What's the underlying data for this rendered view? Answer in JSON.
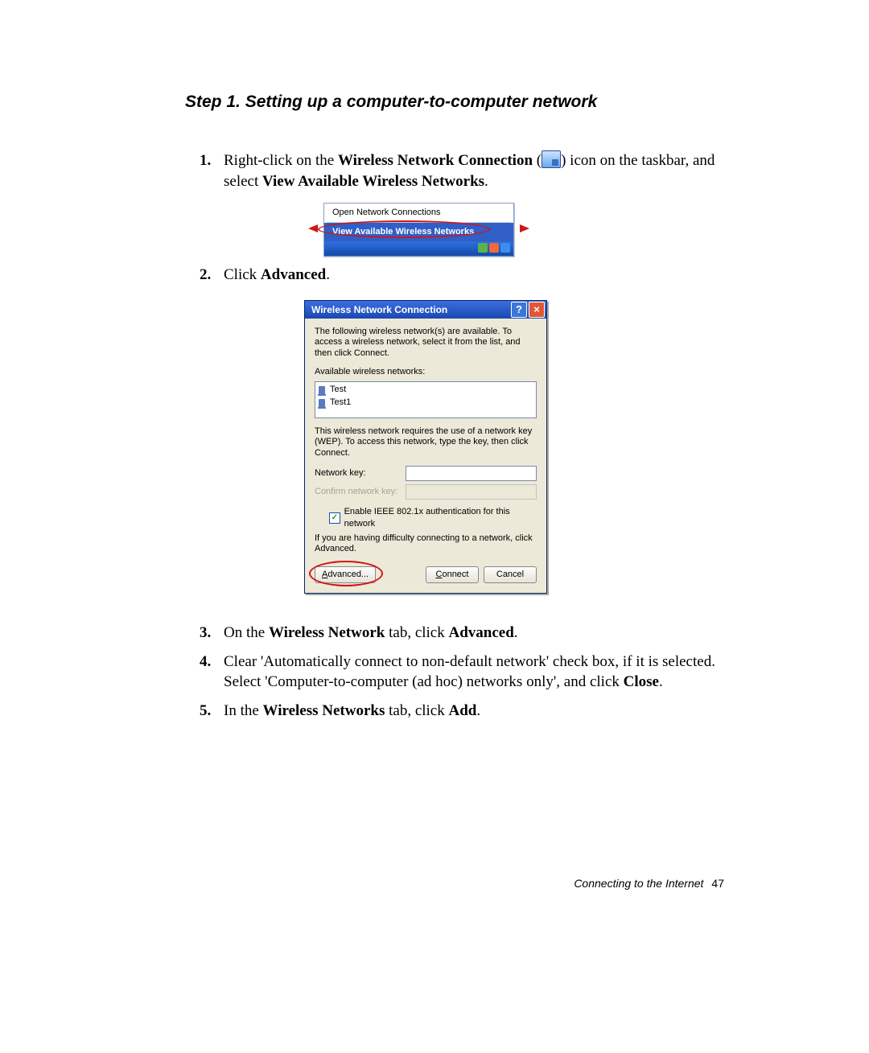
{
  "page": {
    "section_title": "Step 1. Setting up a computer-to-computer network",
    "footer_text": "Connecting to the Internet",
    "page_number": "47"
  },
  "steps": {
    "s1_a": "Right-click on the ",
    "s1_bold1": "Wireless Network Connection",
    "s1_b": " (",
    "s1_c": ") icon on the taskbar, and select ",
    "s1_bold2": "View Available Wireless Networks",
    "s1_d": ".",
    "s2_a": "Click ",
    "s2_bold": "Advanced",
    "s2_b": ".",
    "s3_a": "On the ",
    "s3_bold1": "Wireless Network",
    "s3_b": " tab, click ",
    "s3_bold2": "Advanced",
    "s3_c": ".",
    "s4": "Clear 'Automatically connect to non-default network' check box, if it is selected. Select 'Computer-to-computer (ad hoc) networks only', and click ",
    "s4_bold": "Close",
    "s4_b": ".",
    "s5_a": "In the ",
    "s5_bold1": "Wireless Networks",
    "s5_b": " tab, click ",
    "s5_bold2": "Add",
    "s5_c": "."
  },
  "menu": {
    "item1": "Open Network Connections",
    "item2": "View Available Wireless Networks"
  },
  "dialog": {
    "title": "Wireless Network Connection",
    "intro": "The following wireless network(s) are available. To access a wireless network, select it from the list, and then click Connect.",
    "avail_label": "Available wireless networks:",
    "nets": [
      "Test",
      "Test1"
    ],
    "wep_note": "This wireless network requires the use of a network key (WEP). To access this network, type the key, then click Connect.",
    "key_label": "Network key:",
    "confirm_label": "Confirm network key:",
    "enable_8021x": "Enable IEEE 802.1x authentication for this network",
    "difficulty": "If you are having difficulty connecting to a network, click Advanced.",
    "btn_advanced": "Advanced...",
    "btn_connect": "Connect",
    "btn_cancel": "Cancel",
    "help_glyph": "?",
    "close_glyph": "×",
    "check_glyph": "✓"
  }
}
